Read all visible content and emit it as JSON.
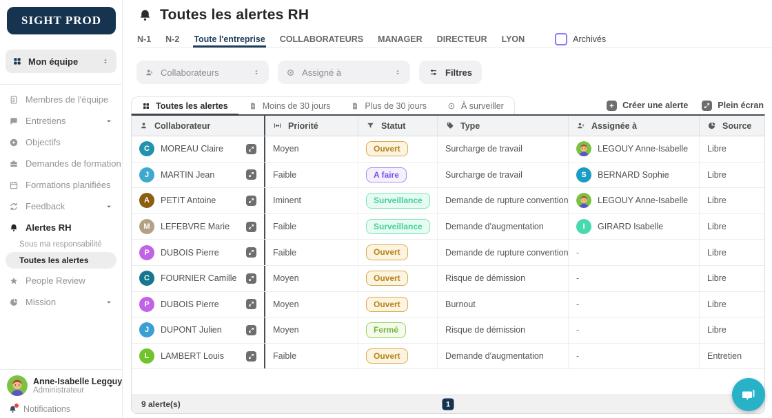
{
  "logo_text": "SIGHT PROD",
  "team_selector": {
    "label": "Mon équipe"
  },
  "sidebar": {
    "items": [
      {
        "label": "Membres de l'équipe"
      },
      {
        "label": "Entretiens"
      },
      {
        "label": "Objectifs"
      },
      {
        "label": "Demandes de formation"
      },
      {
        "label": "Formations planifiées"
      },
      {
        "label": "Feedback"
      },
      {
        "label": "Alertes RH"
      },
      {
        "label": "People Review"
      },
      {
        "label": "Mission"
      }
    ],
    "alerts_subitems": [
      {
        "label": "Sous ma responsabilité"
      },
      {
        "label": "Toutes les alertes"
      }
    ]
  },
  "user": {
    "name": "Anne-Isabelle Legouy",
    "role": "Administrateur"
  },
  "notifications": {
    "label": "Notifications"
  },
  "header": {
    "title": "Toutes les alertes RH"
  },
  "scope_tabs": [
    {
      "label": "N-1"
    },
    {
      "label": "N-2"
    },
    {
      "label": "Toute l'entreprise",
      "active": true
    },
    {
      "label": "COLLABORATEURS"
    },
    {
      "label": "MANAGER"
    },
    {
      "label": "DIRECTEUR"
    },
    {
      "label": "LYON"
    }
  ],
  "archived": {
    "label": "Archivés",
    "checked": false
  },
  "filters": {
    "collaborateurs_placeholder": "Collaborateurs",
    "assigne_placeholder": "Assigné à",
    "filtres_label": "Filtres"
  },
  "view_tabs": [
    {
      "label": "Toutes les alertes",
      "active": true
    },
    {
      "label": "Moins de 30 jours"
    },
    {
      "label": "Plus de 30 jours"
    },
    {
      "label": "À surveiller"
    }
  ],
  "actions": {
    "create": "Créer une alerte",
    "fullscreen": "Plein écran"
  },
  "colors": {
    "navy": "#16334f",
    "accent_underline": "#1c3c5d",
    "checkbox_border": "#8b7bf5",
    "chat_bubble": "#27b2c8",
    "status": {
      "Ouvert": {
        "text": "#b5831c",
        "border": "#d9a84e",
        "bg": "#fdf4e0"
      },
      "A faire": {
        "text": "#7a4fe0",
        "border": "#a98df2",
        "bg": "#f4f0fe"
      },
      "Surveillance": {
        "text": "#41d096",
        "border": "#7fe4b8",
        "bg": "#e6fbf1"
      },
      "Fermé": {
        "text": "#76b43f",
        "border": "#9ccf6a",
        "bg": "#f4fbea"
      }
    }
  },
  "table": {
    "columns": [
      {
        "label": "Collaborateur"
      },
      {
        "label": "Priorité"
      },
      {
        "label": "Statut"
      },
      {
        "label": "Type"
      },
      {
        "label": "Assignée à"
      },
      {
        "label": "Source"
      }
    ],
    "rows": [
      {
        "initial": "C",
        "avatar_color": "#2292ad",
        "name": "MOREAU Claire",
        "priority": "Moyen",
        "status": "Ouvert",
        "type": "Surcharge de travail",
        "assignee": {
          "kind": "photo",
          "name": "LEGOUY Anne-Isabelle"
        },
        "source": "Libre"
      },
      {
        "initial": "J",
        "avatar_color": "#3ea8cf",
        "name": "MARTIN Jean",
        "priority": "Faible",
        "status": "A faire",
        "type": "Surcharge de travail",
        "assignee": {
          "kind": "initial",
          "initial": "S",
          "color": "#189dc4",
          "name": "BERNARD Sophie"
        },
        "source": "Libre"
      },
      {
        "initial": "A",
        "avatar_color": "#8d5e10",
        "name": "PETIT Antoine",
        "priority": "Iminent",
        "status": "Surveillance",
        "type": "Demande de rupture conventionnelle",
        "assignee": {
          "kind": "photo",
          "name": "LEGOUY Anne-Isabelle"
        },
        "source": "Libre"
      },
      {
        "initial": "M",
        "avatar_color": "#b1a287",
        "name": "LEFEBVRE Marie",
        "priority": "Faible",
        "status": "Surveillance",
        "type": "Demande d'augmentation",
        "assignee": {
          "kind": "initial",
          "initial": "I",
          "color": "#49d9ae",
          "name": "GIRARD Isabelle"
        },
        "source": "Libre"
      },
      {
        "initial": "P",
        "avatar_color": "#c263e6",
        "name": "DUBOIS Pierre",
        "priority": "Faible",
        "status": "Ouvert",
        "type": "Demande de rupture conventionnelle",
        "assignee": null,
        "source": "Libre"
      },
      {
        "initial": "C",
        "avatar_color": "#17768f",
        "name": "FOURNIER Camille",
        "priority": "Moyen",
        "status": "Ouvert",
        "type": "Risque de démission",
        "assignee": null,
        "source": "Libre"
      },
      {
        "initial": "P",
        "avatar_color": "#c263e6",
        "name": "DUBOIS Pierre",
        "priority": "Moyen",
        "status": "Ouvert",
        "type": "Burnout",
        "assignee": null,
        "source": "Libre"
      },
      {
        "initial": "J",
        "avatar_color": "#3a9fd2",
        "name": "DUPONT Julien",
        "priority": "Moyen",
        "status": "Fermé",
        "type": "Risque de démission",
        "assignee": null,
        "source": "Libre"
      },
      {
        "initial": "L",
        "avatar_color": "#70c32b",
        "name": "LAMBERT Louis",
        "priority": "Faible",
        "status": "Ouvert",
        "type": "Demande d'augmentation",
        "assignee": null,
        "source": "Entretien"
      }
    ]
  },
  "footer": {
    "count_label": "9 alerte(s)",
    "page": "1"
  }
}
